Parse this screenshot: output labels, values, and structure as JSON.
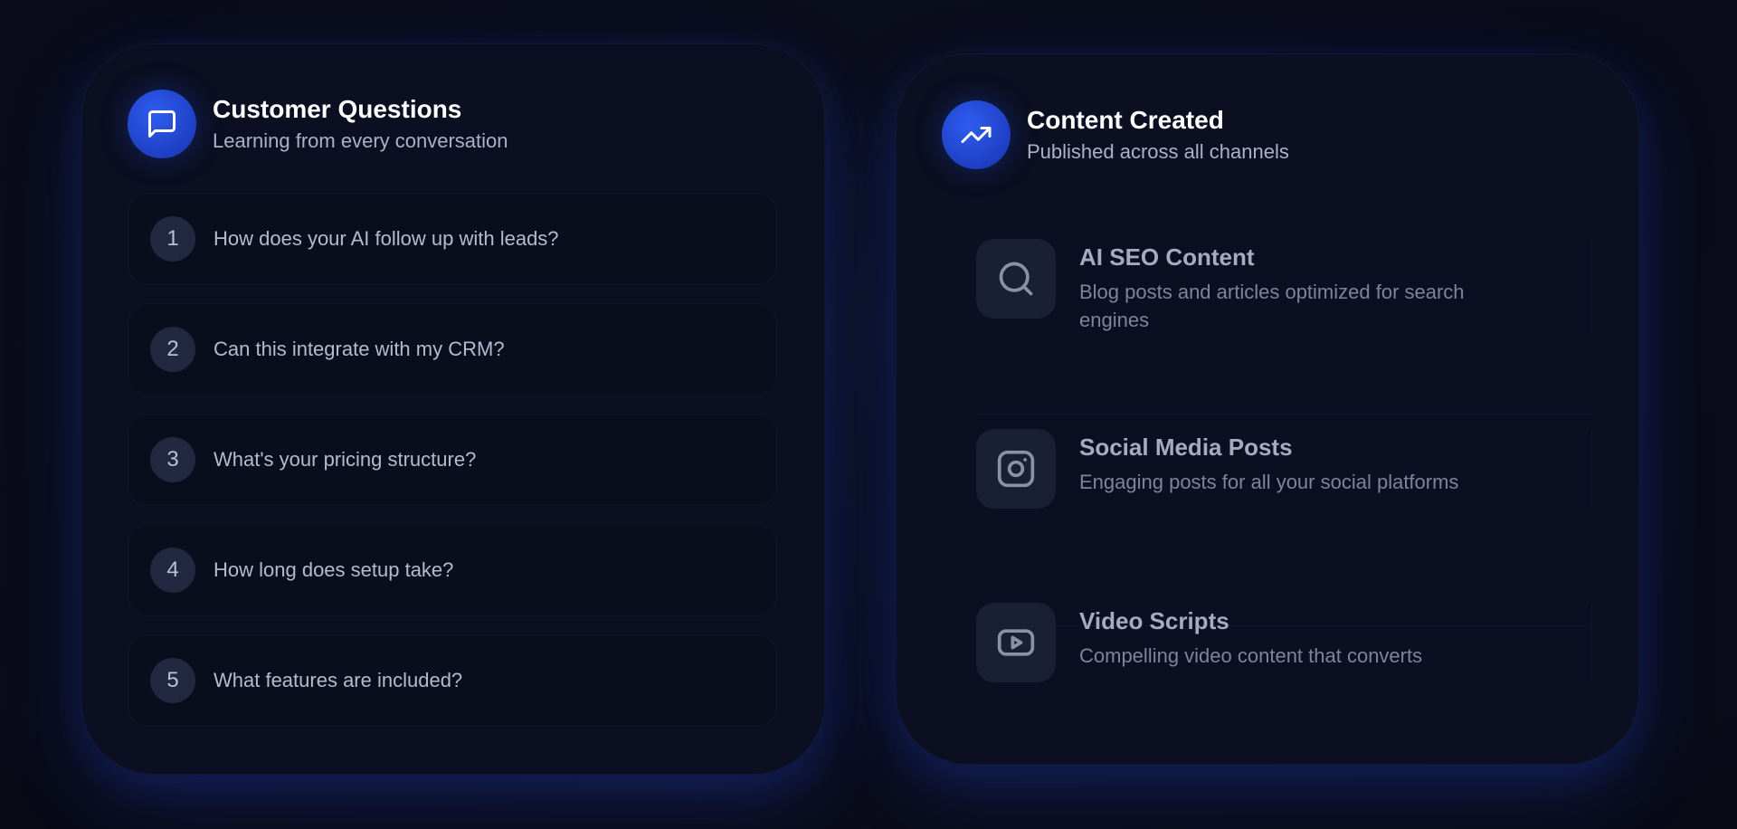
{
  "questions_card": {
    "title": "Customer Questions",
    "subtitle": "Learning from every conversation",
    "icon": "message-square-icon",
    "items": [
      {
        "number": "1",
        "text": "How does your AI follow up with leads?"
      },
      {
        "number": "2",
        "text": "Can this integrate with my CRM?"
      },
      {
        "number": "3",
        "text": "What's your pricing structure?"
      },
      {
        "number": "4",
        "text": "How long does setup take?"
      },
      {
        "number": "5",
        "text": "What features are included?"
      }
    ]
  },
  "content_card": {
    "title": "Content Created",
    "subtitle": "Published across all channels",
    "icon": "trending-up-icon",
    "items": [
      {
        "icon": "search-icon",
        "title": "AI SEO Content",
        "description": "Blog posts and articles optimized for search engines"
      },
      {
        "icon": "instagram-icon",
        "title": "Social Media Posts",
        "description": "Engaging posts for all your social platforms"
      },
      {
        "icon": "youtube-icon",
        "title": "Video Scripts",
        "description": "Compelling video content that converts"
      }
    ]
  },
  "colors": {
    "accent": "#2f5df0",
    "background": "#0a0c1a",
    "card": "#0b0f21"
  }
}
